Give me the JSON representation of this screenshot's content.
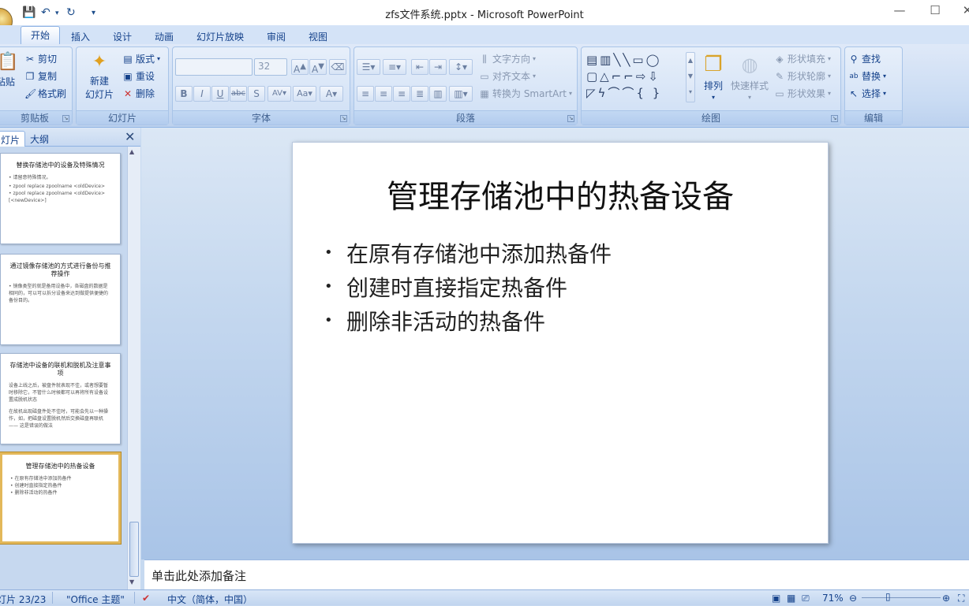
{
  "window": {
    "title": "zfs文件系统.pptx - Microsoft PowerPoint"
  },
  "qat": [
    "save-icon",
    "undo-icon",
    "redo-icon",
    "customize-icon"
  ],
  "tabs": [
    "开始",
    "插入",
    "设计",
    "动画",
    "幻灯片放映",
    "审阅",
    "视图"
  ],
  "ribbon": {
    "clipboard": {
      "paste": "粘贴",
      "cut": "剪切",
      "copy": "复制",
      "format_painter": "格式刷",
      "label": "剪贴板"
    },
    "slides": {
      "new_slide_line1": "新建",
      "new_slide_line2": "幻灯片",
      "layout": "版式",
      "reset": "重设",
      "delete": "删除",
      "label": "幻灯片"
    },
    "font": {
      "font_name": "",
      "font_size": "32",
      "label": "字体"
    },
    "paragraph": {
      "text_direction": "文字方向",
      "align_text": "对齐文本",
      "convert_smartart": "转换为 SmartArt",
      "label": "段落"
    },
    "drawing": {
      "arrange": "排列",
      "quick_styles": "快速样式",
      "shape_fill": "形状填充",
      "shape_outline": "形状轮廓",
      "shape_effects": "形状效果",
      "label": "绘图"
    },
    "editing": {
      "find": "查找",
      "replace": "替换",
      "select": "选择",
      "label": "编辑"
    }
  },
  "pane": {
    "tab_slides": "灯片",
    "tab_outline": "大纲"
  },
  "thumbnails": [
    {
      "title": "替换存储池中的设备及特殊情况",
      "lines": [
        "• 请留意特殊情况。",
        "",
        "• zpool replace zpoolname <oldDevice>",
        "• zpool replace zpoolname <oldDevice> [<newDevice>]"
      ]
    },
    {
      "title": "通过镜像存储池的方式进行备份与推荐操作",
      "lines": [
        "• 镜像类型的就是备用设备中，各磁盘的数据是相同的，可以可以拆分设备来达到做提供便捷的备份目的。"
      ]
    },
    {
      "title": "存储池中设备的联机和脱机及注意事项",
      "lines": [
        "设备上线之后，被盘件就表现不佳，或者想要暂时移除它，不管什么时候都可以再将所有设备设置成脱机状态",
        "",
        "在故机出现磁盘件处不佳时，可能会先以一种操作，如，把磁盘设置脱机然后交换磁盘再联机 —— 这是错误的做法"
      ]
    },
    {
      "title": "管理存储池中的热备设备",
      "lines": [
        "• 在原有存储池中添加热备件",
        "• 创建时直接指定热备件",
        "• 删除非活动的热备件"
      ]
    }
  ],
  "slide": {
    "title": "管理存储池中的热备设备",
    "bullets": [
      "在原有存储池中添加热备件",
      "创建时直接指定热备件",
      "删除非活动的热备件"
    ]
  },
  "notes": {
    "placeholder": "单击此处添加备注"
  },
  "status": {
    "slide_count": "灯片 23/23",
    "theme": "\"Office 主题\"",
    "language": "中文（简体，中国）",
    "zoom": "71%"
  }
}
